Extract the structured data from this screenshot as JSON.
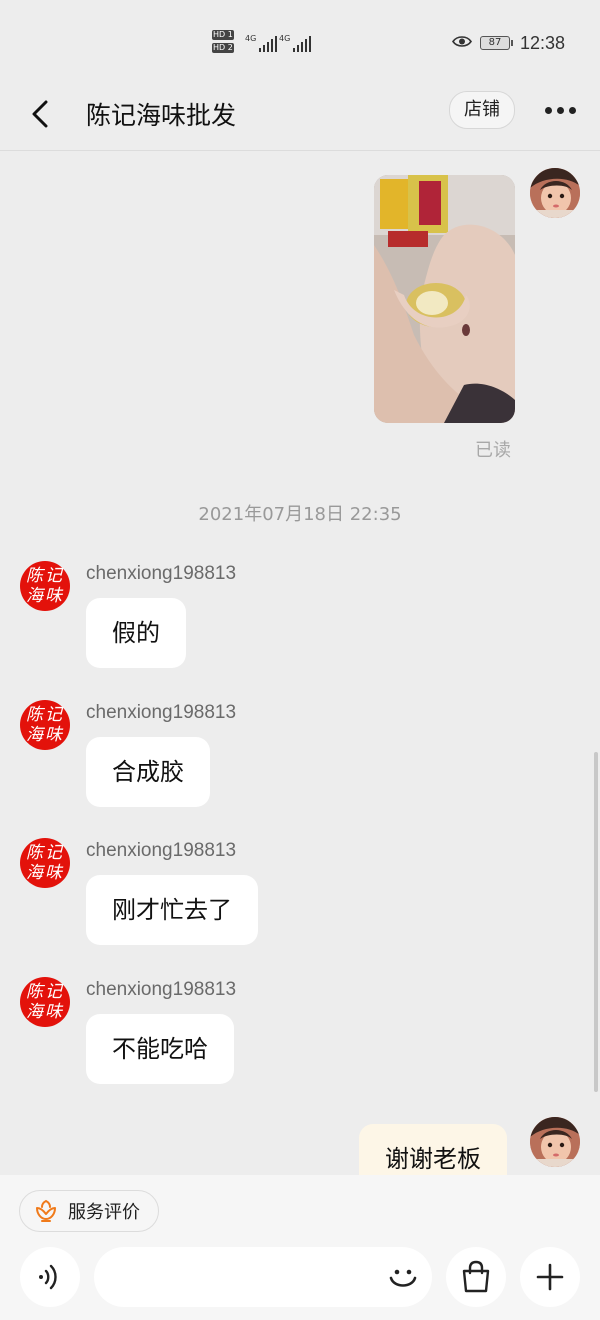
{
  "status_bar": {
    "sim1": "HD 1",
    "sim2": "HD 2",
    "net1": "4G",
    "net2": "4G",
    "battery": "87",
    "time": "12:38"
  },
  "header": {
    "title": "陈记海味批发",
    "shop_button": "店铺"
  },
  "shop_avatar_text": [
    "陈记",
    "海味"
  ],
  "messages": {
    "read_status": "已读",
    "timestamp": "2021年07月18日 22:35",
    "incoming": [
      {
        "sender": "chenxiong198813",
        "text": "假的"
      },
      {
        "sender": "chenxiong198813",
        "text": "合成胶"
      },
      {
        "sender": "chenxiong198813",
        "text": "刚才忙去了"
      },
      {
        "sender": "chenxiong198813",
        "text": "不能吃哈"
      }
    ],
    "outgoing_last": "谢谢老板"
  },
  "bottom": {
    "service_label": "服务评价"
  },
  "colors": {
    "background": "#ededed",
    "incoming_bubble": "#ffffff",
    "outgoing_bubble": "#fdf6e7",
    "shop_avatar": "#e3120b",
    "service_icon": "#f07a1a"
  }
}
